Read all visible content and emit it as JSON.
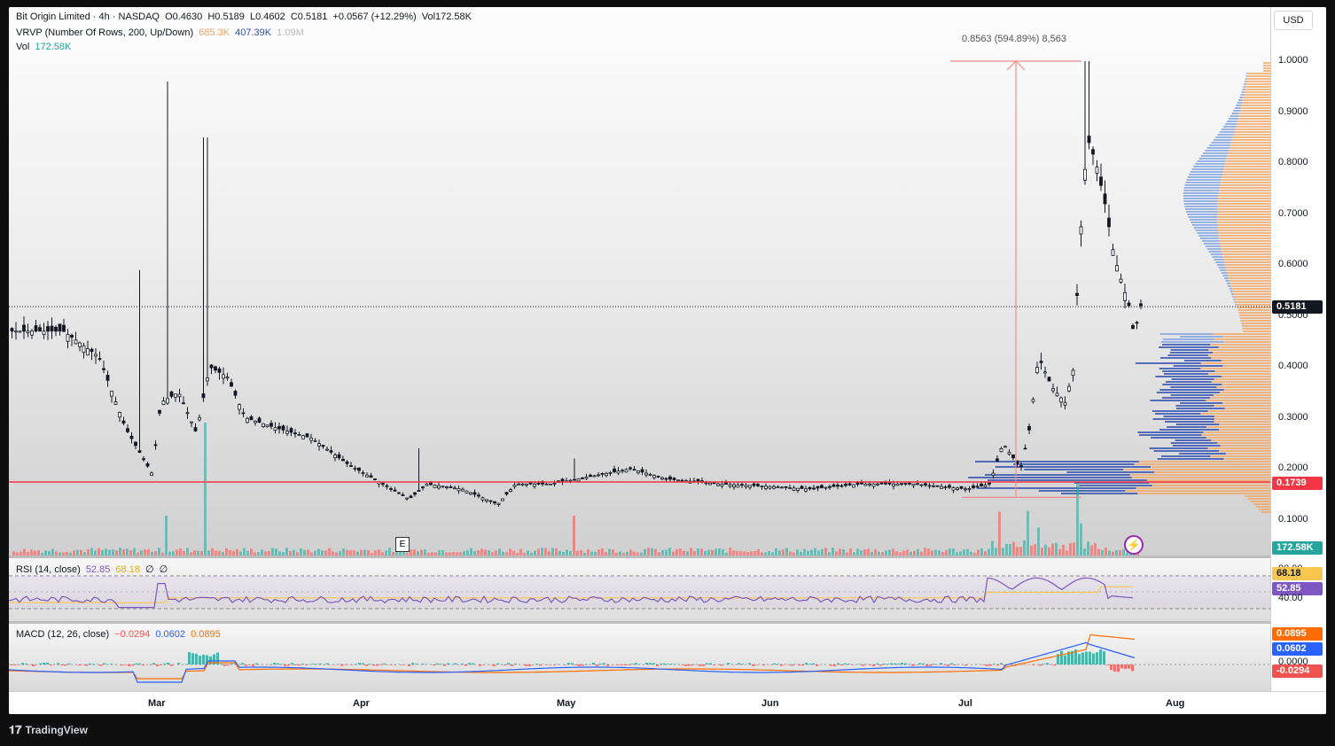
{
  "legend": {
    "symbol": "Bit Origin Limited · 4h · NASDAQ",
    "open": "O0.4630",
    "high": "H0.5189",
    "low": "L0.4602",
    "close": "C0.5181",
    "change": "+0.0567 (+12.29%)",
    "volume": "Vol172.58K",
    "vrvp_label": "VRVP (Number Of Rows, 200, Up/Down)",
    "vrvp_up": "685.3K",
    "vrvp_down": "407.39K",
    "vrvp_total": "1.09M",
    "vol_label": "Vol",
    "vol_value": "172.58K"
  },
  "currency": "USD",
  "price_scale": [
    "1.0000",
    "0.9000",
    "0.8000",
    "0.7000",
    "0.6000",
    "0.5000",
    "0.4000",
    "0.3000",
    "0.2000",
    "0.1000"
  ],
  "price_tags": {
    "last": "0.5181",
    "line": "0.1739",
    "volume": "172.58K"
  },
  "measure": {
    "label": "0.8563 (594.89%) 8,563"
  },
  "earnings_badge": "E",
  "rsi": {
    "label": "RSI (14, close)",
    "value": "52.85",
    "ma": "68.18",
    "extra1": "∅",
    "extra2": "∅",
    "scale_top": "80.00",
    "scale_bottom": "40.00",
    "tag_ma": "68.18",
    "tag_rsi": "52.85"
  },
  "macd": {
    "label": "MACD (12, 26, close)",
    "hist": "−0.0294",
    "macd": "0.0602",
    "signal": "0.0895",
    "scale_zero": "0.0000",
    "tag_signal": "0.0895",
    "tag_macd": "0.0602",
    "tag_hist": "-0.0294"
  },
  "time_axis": [
    "Mar",
    "Apr",
    "May",
    "Jun",
    "Jul",
    "Aug"
  ],
  "brand": "TradingView",
  "colors": {
    "up": "#26a69a",
    "down": "#ef5350",
    "candle": "#131722",
    "rsi": "#7e57c2",
    "rsi_ma": "#f9c74f",
    "macd": "#2962ff",
    "signal": "#ff6d00",
    "vp_up": "#f2a35e",
    "vp_down": "#2f4fb0",
    "hline": "#f23645"
  },
  "chart_data": {
    "type": "candlestick",
    "ylim": [
      0.05,
      1.05
    ],
    "ohlc_approx": [
      {
        "t": "Feb",
        "close": 0.47
      },
      {
        "t": "Mar",
        "close": 0.33
      },
      {
        "t": "Apr",
        "close": 0.16
      },
      {
        "t": "May",
        "close": 0.18
      },
      {
        "t": "Jun",
        "close": 0.16
      },
      {
        "t": "Jul",
        "close": 0.18
      },
      {
        "t": "Jul-peak",
        "high": 1.0
      },
      {
        "t": "last",
        "open": 0.463,
        "high": 0.5189,
        "low": 0.4602,
        "close": 0.5181
      }
    ],
    "horizontal_line": 0.1739
  }
}
